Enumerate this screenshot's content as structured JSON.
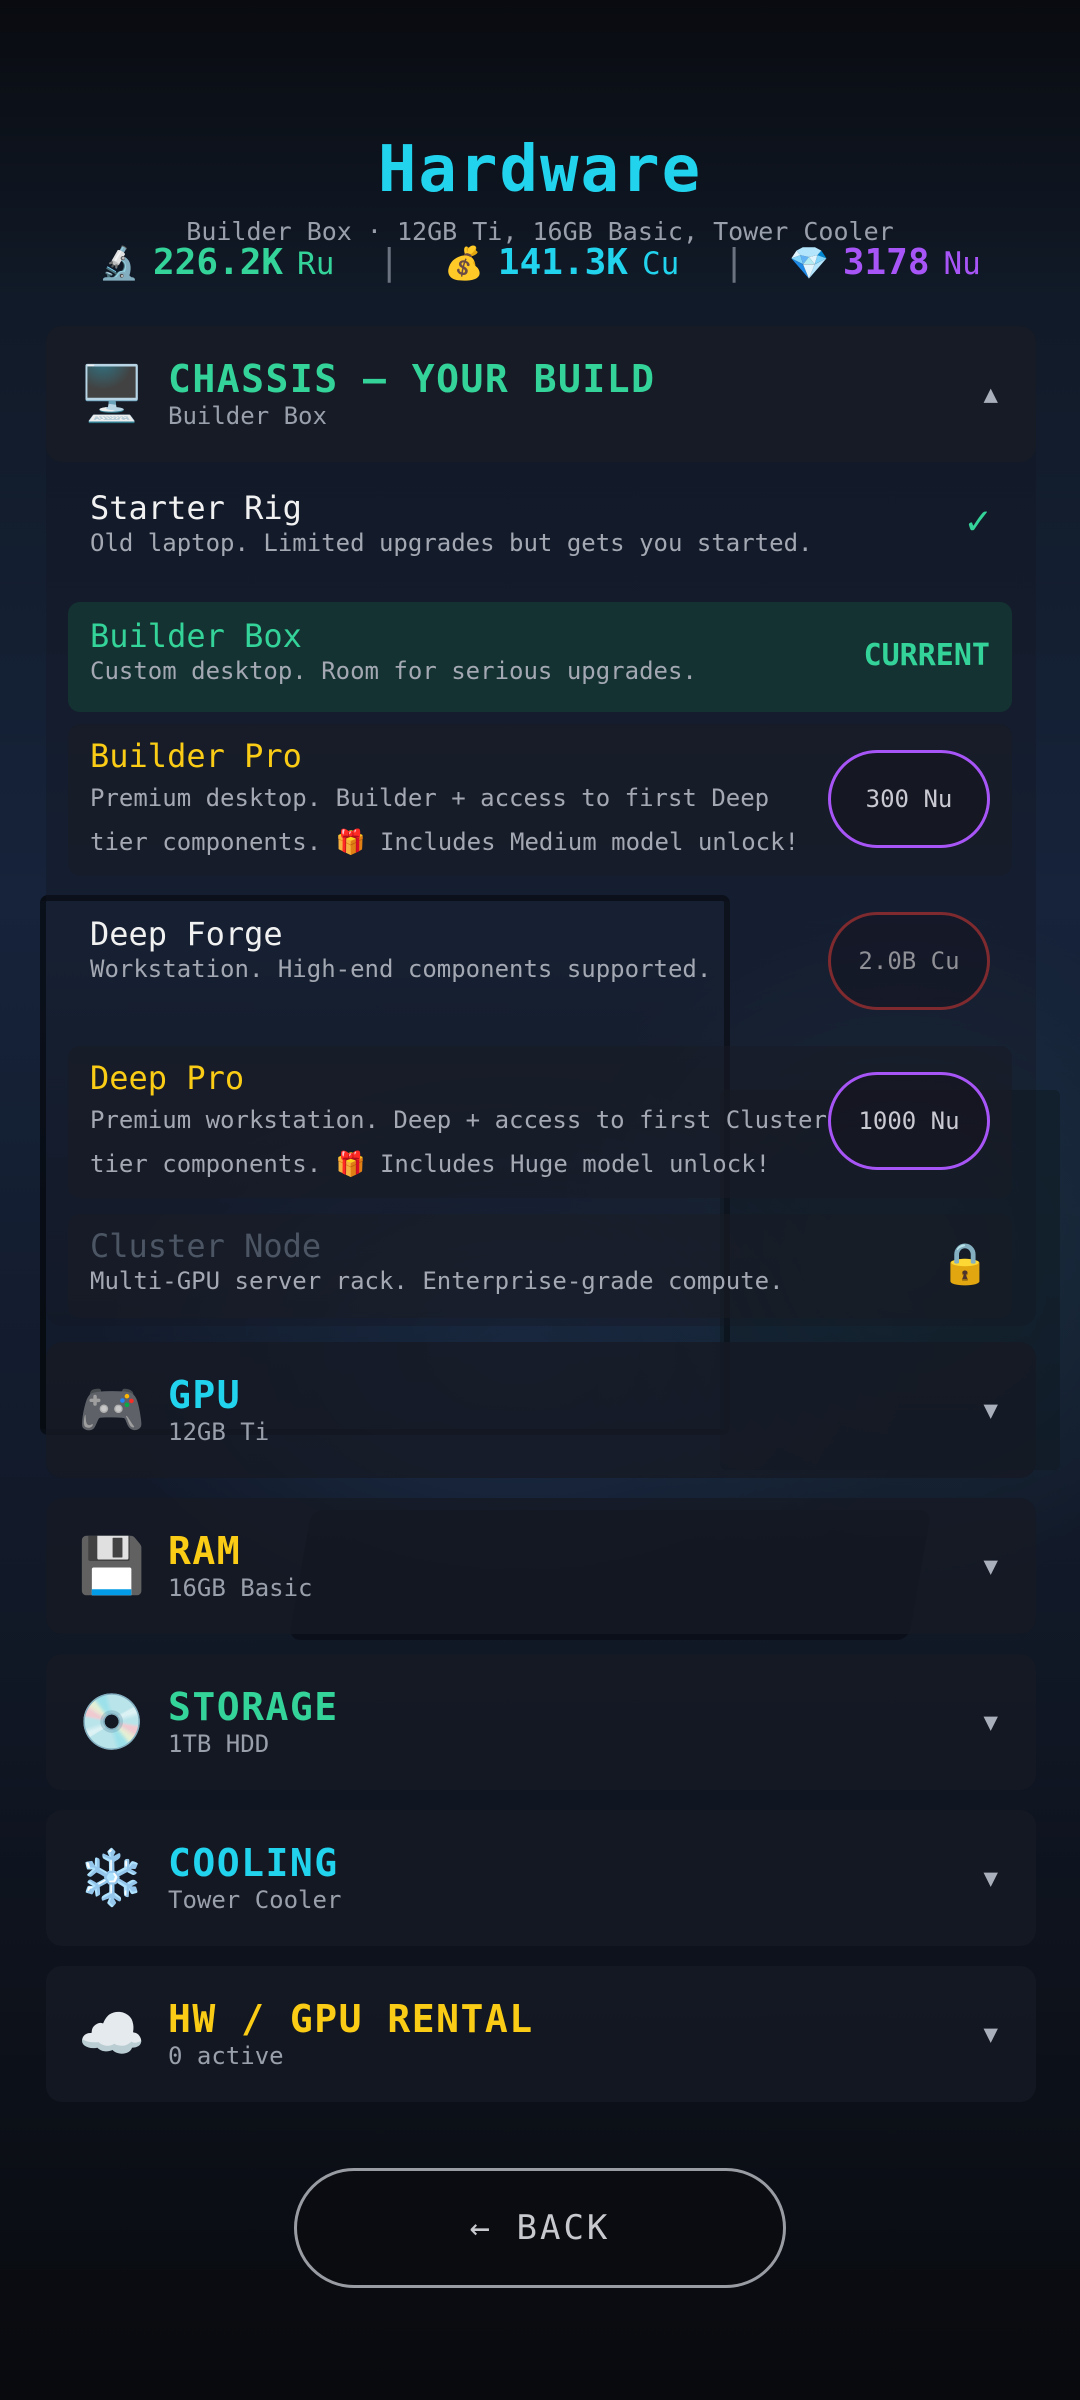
{
  "header": {
    "title": "Hardware",
    "subtitle": "Builder Box · 12GB Ti, 16GB Basic, Tower Cooler"
  },
  "currencies": [
    {
      "icon": "🔬",
      "icon_name": "microscope-icon",
      "value": "226.2K",
      "unit": "Ru",
      "color": "#34d399"
    },
    {
      "icon": "💰",
      "icon_name": "money-bag-icon",
      "value": "141.3K",
      "unit": "Cu",
      "color": "#22d3ee"
    },
    {
      "icon": "💎",
      "icon_name": "gem-icon",
      "value": "3178",
      "unit": "Nu",
      "color": "#a855f7"
    }
  ],
  "chassis": {
    "icon": "🖥️",
    "title": "CHASSIS — YOUR BUILD",
    "subtitle": "Builder Box",
    "chevron": "▲",
    "options": [
      {
        "name": "Starter Rig",
        "desc": "Old laptop. Limited upgrades but gets you started.",
        "status": "✓"
      },
      {
        "name": "Builder Box",
        "desc": "Custom desktop. Room for serious upgrades.",
        "status": "CURRENT"
      },
      {
        "name": "Builder Pro",
        "desc_line1": "Premium desktop. Builder + access to first Deep",
        "desc_line2": "tier components. 🎁 Includes Medium model unlock!",
        "price": "300 Nu"
      },
      {
        "name": "Deep Forge",
        "desc": "Workstation. High-end components supported.",
        "price": "2.0B Cu"
      },
      {
        "name": "Deep Pro",
        "desc_line1": "Premium workstation. Deep + access to first Cluster",
        "desc_line2": "tier components. 🎁 Includes Huge model unlock!",
        "price": "1000 Nu"
      },
      {
        "name": "Cluster Node",
        "desc": "Multi-GPU server rack. Enterprise-grade compute.",
        "status": "🔒"
      }
    ]
  },
  "sections": [
    {
      "icon": "🎮",
      "title": "GPU",
      "subtitle": "12GB Ti",
      "chevron": "▼"
    },
    {
      "icon": "💾",
      "title": "RAM",
      "subtitle": "16GB Basic",
      "chevron": "▼"
    },
    {
      "icon": "💿",
      "title": "STORAGE",
      "subtitle": "1TB HDD",
      "chevron": "▼"
    },
    {
      "icon": "❄️",
      "title": "COOLING",
      "subtitle": "Tower Cooler",
      "chevron": "▼"
    },
    {
      "icon": "☁️",
      "title": "HW / GPU RENTAL",
      "subtitle": "0 active",
      "chevron": "▼"
    }
  ],
  "back_label": "← BACK",
  "colors": {
    "accent_cyan": "#22d3ee",
    "accent_green": "#34d399",
    "accent_yellow": "#facc15",
    "accent_purple": "#a855f7"
  }
}
